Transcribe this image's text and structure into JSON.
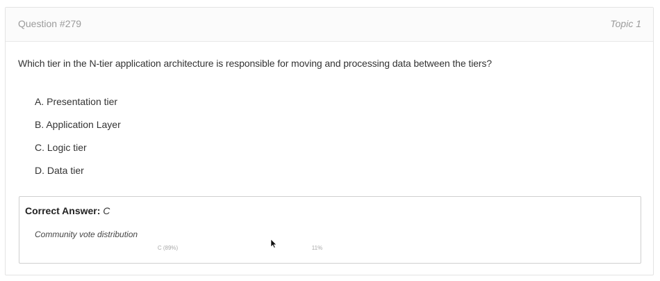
{
  "header": {
    "question_number": "Question #279",
    "topic": "Topic 1"
  },
  "question": {
    "text": "Which tier in the N-tier application architecture is responsible for moving and processing data between the tiers?"
  },
  "choices": [
    {
      "label": "A. Presentation tier"
    },
    {
      "label": "B. Application Layer"
    },
    {
      "label": "C. Logic tier"
    },
    {
      "label": "D. Data tier"
    }
  ],
  "answer": {
    "label": "Correct Answer:",
    "value": "C"
  },
  "votes": {
    "title": "Community vote distribution",
    "segments": [
      {
        "label": "C (89%)",
        "share": 0.89
      },
      {
        "label": "11%",
        "share": 0.11
      }
    ]
  }
}
